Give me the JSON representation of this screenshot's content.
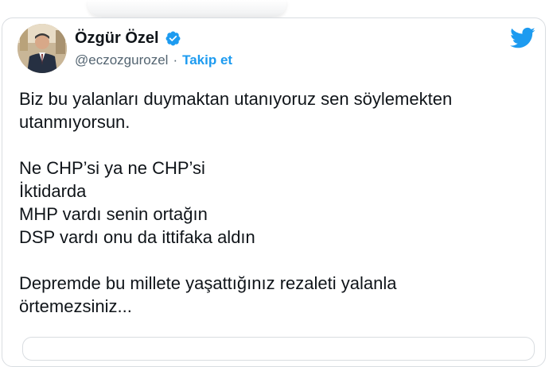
{
  "tweet": {
    "author": {
      "display_name": "Özgür Özel",
      "handle": "@eczozgurozel",
      "verified": true,
      "separator": "·",
      "follow_label": "Takip et"
    },
    "brand_icon": "twitter-bird-icon",
    "paragraphs": [
      {
        "lines": [
          "Biz bu yalanları duymaktan utanıyoruz sen söylemekten",
          "utanmıyorsun."
        ]
      },
      {
        "lines": [
          "Ne CHP’si ya ne CHP’si",
          "İktidarda",
          "MHP vardı senin ortağın",
          "DSP vardı onu da ittifaka aldın"
        ]
      },
      {
        "lines": [
          "Depremde bu millete yaşattığınız rezaleti yalanla",
          "örtemezsiniz..."
        ]
      }
    ]
  },
  "colors": {
    "text": "#0f1419",
    "secondary_text": "#536471",
    "accent": "#1d9bf0",
    "border": "#d9dde1"
  }
}
